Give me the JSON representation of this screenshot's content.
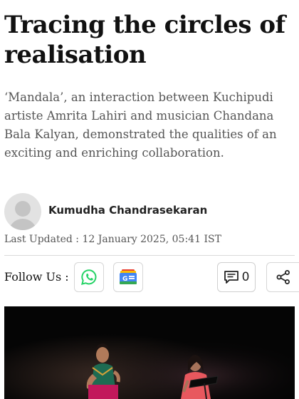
{
  "article": {
    "headline": "Tracing the circles of realisation",
    "standfirst": "‘Mandala’, an interaction between Kuchipudi artiste Amrita Lahiri and musician Chandana Bala Kalyan, demonstrated the qualities of an exciting and enriching collaboration.",
    "author": "Kumudha Chandrasekaran",
    "last_updated": "Last Updated : 12 January 2025, 05:41 IST"
  },
  "toolbar": {
    "follow_label": "Follow Us :",
    "comment_count": "0",
    "icons": {
      "whatsapp": "whatsapp-icon",
      "google_news": "google-news-icon",
      "comment": "comment-icon",
      "share": "share-icon"
    }
  },
  "colors": {
    "whatsapp_green": "#25d366",
    "gnews_blue": "#4285f4",
    "gnews_red": "#ea4335",
    "gnews_yellow": "#fbbc04",
    "gnews_green": "#34a853"
  }
}
